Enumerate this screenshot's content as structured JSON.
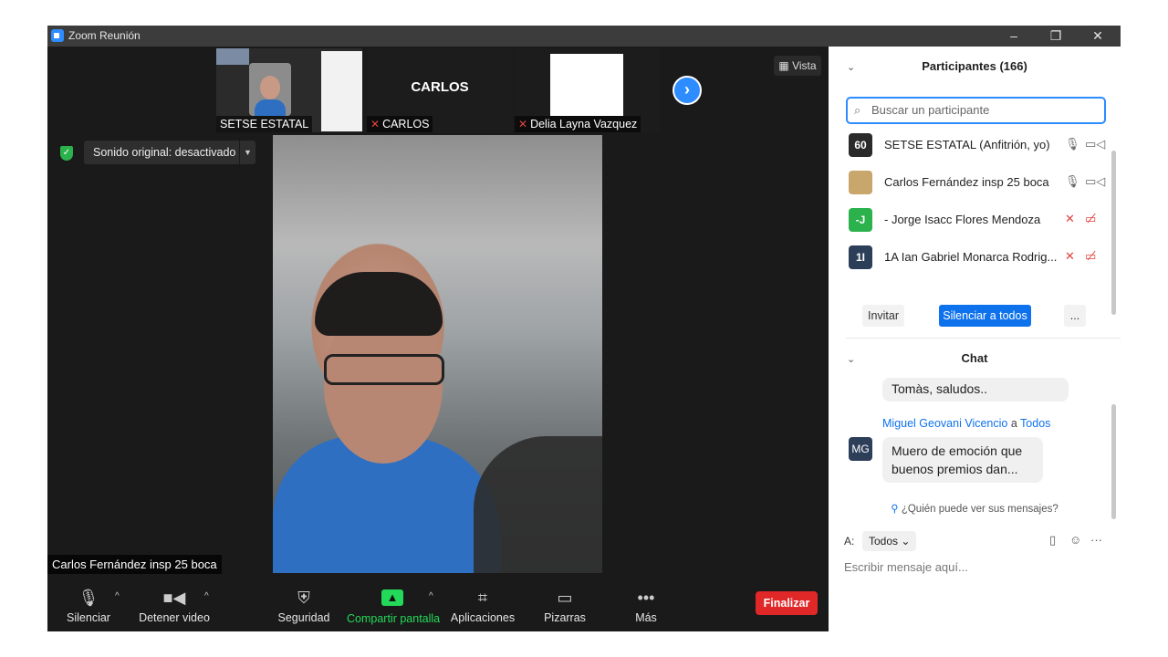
{
  "window": {
    "title": "Zoom Reunión",
    "minimize": "–",
    "restore": "❐",
    "close": "✕"
  },
  "filmstrip": {
    "thumbs": [
      {
        "label": "SETSE ESTATAL"
      },
      {
        "name": "CARLOS",
        "label": "CARLOS",
        "muted": true
      },
      {
        "label": "Delia Layna Vazquez",
        "muted": true
      }
    ],
    "next": "›",
    "view_label": "Vista"
  },
  "audio": {
    "sound_label": "Sonido original: desactivado",
    "shield": "✓"
  },
  "main_video": {
    "speaker_name": "Carlos Fernández insp 25 boca"
  },
  "toolbar": {
    "mute": "Silenciar",
    "video": "Detener video",
    "security": "Seguridad",
    "share": "Compartir pantalla",
    "apps": "Aplicaciones",
    "whiteboards": "Pizarras",
    "more": "Más",
    "end": "Finalizar",
    "share_color": "#23d959",
    "end_color": "#e02828"
  },
  "participants": {
    "title": "Participantes (166)",
    "search_placeholder": "Buscar un participante",
    "list": [
      {
        "initials": "60",
        "name": "SETSE ESTATAL (Anfitrión, yo)",
        "avatar_color": "#2a2a2a",
        "muted": false
      },
      {
        "initials": "",
        "name": "Carlos Fernández insp 25 boca",
        "avatar_color": "#c9a66b",
        "muted": false
      },
      {
        "initials": "-J",
        "name": "- Jorge Isacc Flores Mendoza",
        "avatar_color": "#2bb24c",
        "muted": true
      },
      {
        "initials": "1I",
        "name": "1A Ian Gabriel Monarca Rodrig...",
        "avatar_color": "#2c3e58",
        "muted": true
      }
    ],
    "invite": "Invitar",
    "mute_all": "Silenciar a todos",
    "more": "..."
  },
  "chat": {
    "title": "Chat",
    "prev_message": "Tomàs, saludos..",
    "sender": "Miguel Geovani Vicencio",
    "to_word": "a",
    "recipient": "Todos",
    "sender_initials": "MG",
    "message": "Muero de emoción que buenos premios dan...",
    "who_can_see": "¿Quién puede ver sus mensajes?",
    "to_label": "A:",
    "to_value": "Todos",
    "input_placeholder": "Escribir mensaje aquí..."
  }
}
